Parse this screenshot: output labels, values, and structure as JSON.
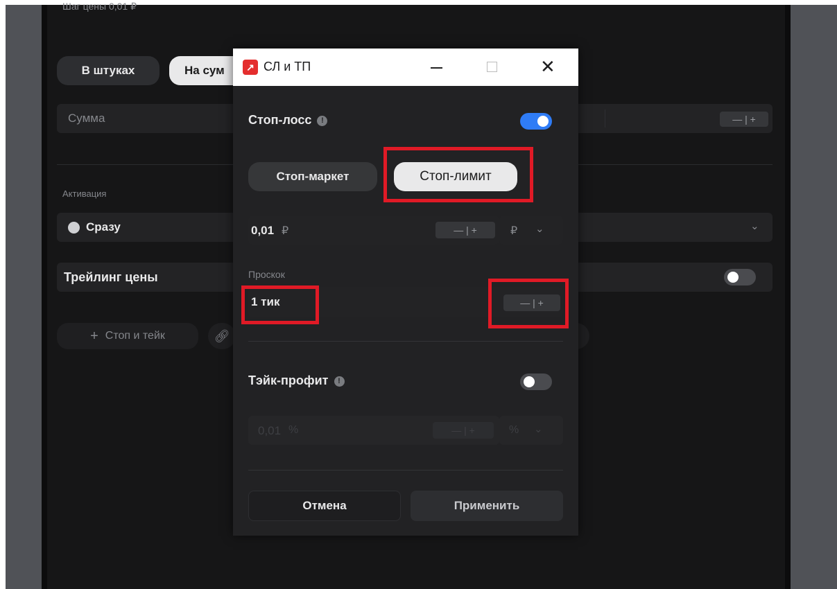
{
  "background_panel": {
    "price_step_text": "Шаг цены 0,01 ₽",
    "mode_tabs": [
      "В штуках",
      "На сум"
    ],
    "sum_placeholder": "Сумма",
    "activation_label": "Активация",
    "activation_value": "Сразу",
    "trailing_label": "Трейлинг цены",
    "add_stop_take_label": "Стоп и тейк",
    "stepper_symbols": "— | +"
  },
  "dialog": {
    "title": "СЛ и ТП",
    "stop_loss": {
      "label": "Стоп-лосс",
      "enabled": true,
      "tabs": [
        "Стоп-маркет",
        "Стоп-лимит"
      ],
      "selected_tab": "Стоп-лимит",
      "price_value": "0,01",
      "price_unit": "₽",
      "unit_select": "₽",
      "slippage_label": "Проскок",
      "slippage_value": "1 тик"
    },
    "take_profit": {
      "label": "Тэйк-профит",
      "enabled": false,
      "value": "0,01",
      "unit": "%",
      "unit_select": "%"
    },
    "stepper_symbols": "— | +",
    "cancel_label": "Отмена",
    "apply_label": "Применить"
  },
  "colors": {
    "accent_toggle": "#2f7cf6",
    "annotation_red": "#e01a26",
    "dialog_bg": "#222224",
    "panel_bg": "#161617"
  }
}
